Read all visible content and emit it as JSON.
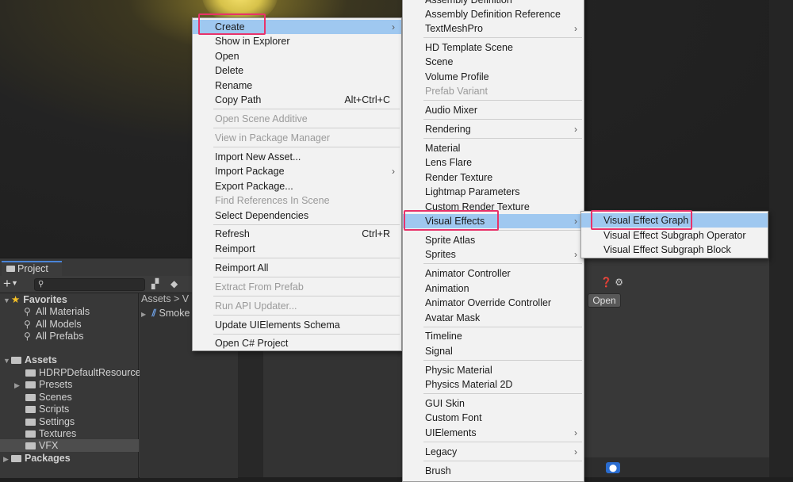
{
  "project_panel": {
    "tab": "Project",
    "search_placeholder": "",
    "tree": {
      "favorites": "Favorites",
      "favorite_items": [
        "All Materials",
        "All Models",
        "All Prefabs"
      ],
      "assets": "Assets",
      "asset_folders": [
        "HDRPDefaultResources",
        "Presets",
        "Scenes",
        "Scripts",
        "Settings",
        "Textures",
        "VFX"
      ],
      "packages": "Packages"
    },
    "breadcrumb": "Assets > V",
    "asset_item": "Smoke"
  },
  "inspector": {
    "open_button": "Open"
  },
  "context_menu": {
    "items": [
      {
        "label": "Create",
        "submenu": true,
        "highlighted": true
      },
      {
        "label": "Show in Explorer"
      },
      {
        "label": "Open"
      },
      {
        "label": "Delete"
      },
      {
        "label": "Rename"
      },
      {
        "label": "Copy Path",
        "shortcut": "Alt+Ctrl+C"
      },
      {
        "label": "Open Scene Additive",
        "disabled": true
      },
      {
        "label": "View in Package Manager",
        "disabled": true
      },
      {
        "label": "Import New Asset..."
      },
      {
        "label": "Import Package",
        "submenu": true
      },
      {
        "label": "Export Package..."
      },
      {
        "label": "Find References In Scene",
        "disabled": true
      },
      {
        "label": "Select Dependencies"
      },
      {
        "label": "Refresh",
        "shortcut": "Ctrl+R"
      },
      {
        "label": "Reimport"
      },
      {
        "label": "Reimport All"
      },
      {
        "label": "Extract From Prefab",
        "disabled": true
      },
      {
        "label": "Run API Updater...",
        "disabled": true
      },
      {
        "label": "Update UIElements Schema"
      },
      {
        "label": "Open C# Project"
      }
    ]
  },
  "create_menu": {
    "items": [
      {
        "label": "Assembly Definition"
      },
      {
        "label": "Assembly Definition Reference"
      },
      {
        "label": "TextMeshPro",
        "submenu": true
      },
      {
        "label": "HD Template Scene"
      },
      {
        "label": "Scene"
      },
      {
        "label": "Volume Profile"
      },
      {
        "label": "Prefab Variant",
        "disabled": true
      },
      {
        "label": "Audio Mixer"
      },
      {
        "label": "Rendering",
        "submenu": true
      },
      {
        "label": "Material"
      },
      {
        "label": "Lens Flare"
      },
      {
        "label": "Render Texture"
      },
      {
        "label": "Lightmap Parameters"
      },
      {
        "label": "Custom Render Texture"
      },
      {
        "label": "Visual Effects",
        "submenu": true,
        "highlighted": true
      },
      {
        "label": "Sprite Atlas"
      },
      {
        "label": "Sprites",
        "submenu": true
      },
      {
        "label": "Animator Controller"
      },
      {
        "label": "Animation"
      },
      {
        "label": "Animator Override Controller"
      },
      {
        "label": "Avatar Mask"
      },
      {
        "label": "Timeline"
      },
      {
        "label": "Signal"
      },
      {
        "label": "Physic Material"
      },
      {
        "label": "Physics Material 2D"
      },
      {
        "label": "GUI Skin"
      },
      {
        "label": "Custom Font"
      },
      {
        "label": "UIElements",
        "submenu": true
      },
      {
        "label": "Legacy",
        "submenu": true
      },
      {
        "label": "Brush"
      }
    ]
  },
  "vfx_menu": {
    "items": [
      {
        "label": "Visual Effect Graph",
        "highlighted": true
      },
      {
        "label": "Visual Effect Subgraph Operator"
      },
      {
        "label": "Visual Effect Subgraph Block"
      }
    ]
  },
  "icons": {
    "submenu_arrow": "›",
    "expand": "▶",
    "collapse": "▼"
  },
  "colors": {
    "menu_bg": "#f2f2f2",
    "menu_highlight": "#9fc8f0",
    "annotation_red": "#e8326a",
    "editor_dark": "#383838"
  }
}
